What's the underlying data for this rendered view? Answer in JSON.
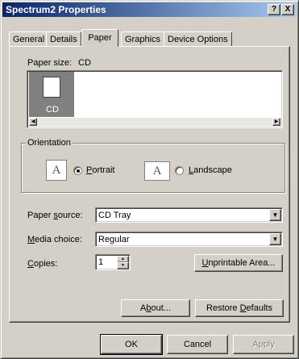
{
  "window": {
    "title": "Spectrum2 Properties",
    "help_btn": "?",
    "close_btn": "X"
  },
  "tabs": [
    {
      "label": "General",
      "active": false
    },
    {
      "label": "Details",
      "active": false
    },
    {
      "label": "Paper",
      "active": true
    },
    {
      "label": "Graphics",
      "active": false
    },
    {
      "label": "Device Options",
      "active": false
    }
  ],
  "paper": {
    "size_label": "Paper size:",
    "size_value": "CD",
    "items": [
      {
        "label": "CD",
        "selected": true
      }
    ]
  },
  "orientation": {
    "legend": "Orientation",
    "portrait_label": "Portrait",
    "portrait_key": "P",
    "portrait_rest": "ortrait",
    "landscape_label": "Landscape",
    "landscape_key": "L",
    "landscape_rest": "andscape",
    "selected": "Portrait",
    "icon_letter": "A"
  },
  "source": {
    "label_pre": "Paper ",
    "label_key": "s",
    "label_post": "ource:",
    "value": "CD Tray"
  },
  "media": {
    "label_key": "M",
    "label_post": "edia choice:",
    "value": "Regular"
  },
  "copies": {
    "label_key": "C",
    "label_post": "opies:",
    "value": "1"
  },
  "buttons": {
    "unprintable_key": "U",
    "unprintable_rest": "nprintable Area...",
    "about_pre": "A",
    "about_key": "b",
    "about_post": "out...",
    "restore_pre": "Restore ",
    "restore_key": "D",
    "restore_post": "efaults",
    "ok": "OK",
    "cancel": "Cancel",
    "apply": "Apply"
  },
  "colors": {
    "title_bar": "#0a246a",
    "face": "#d4d0c8",
    "selection": "#808080"
  }
}
